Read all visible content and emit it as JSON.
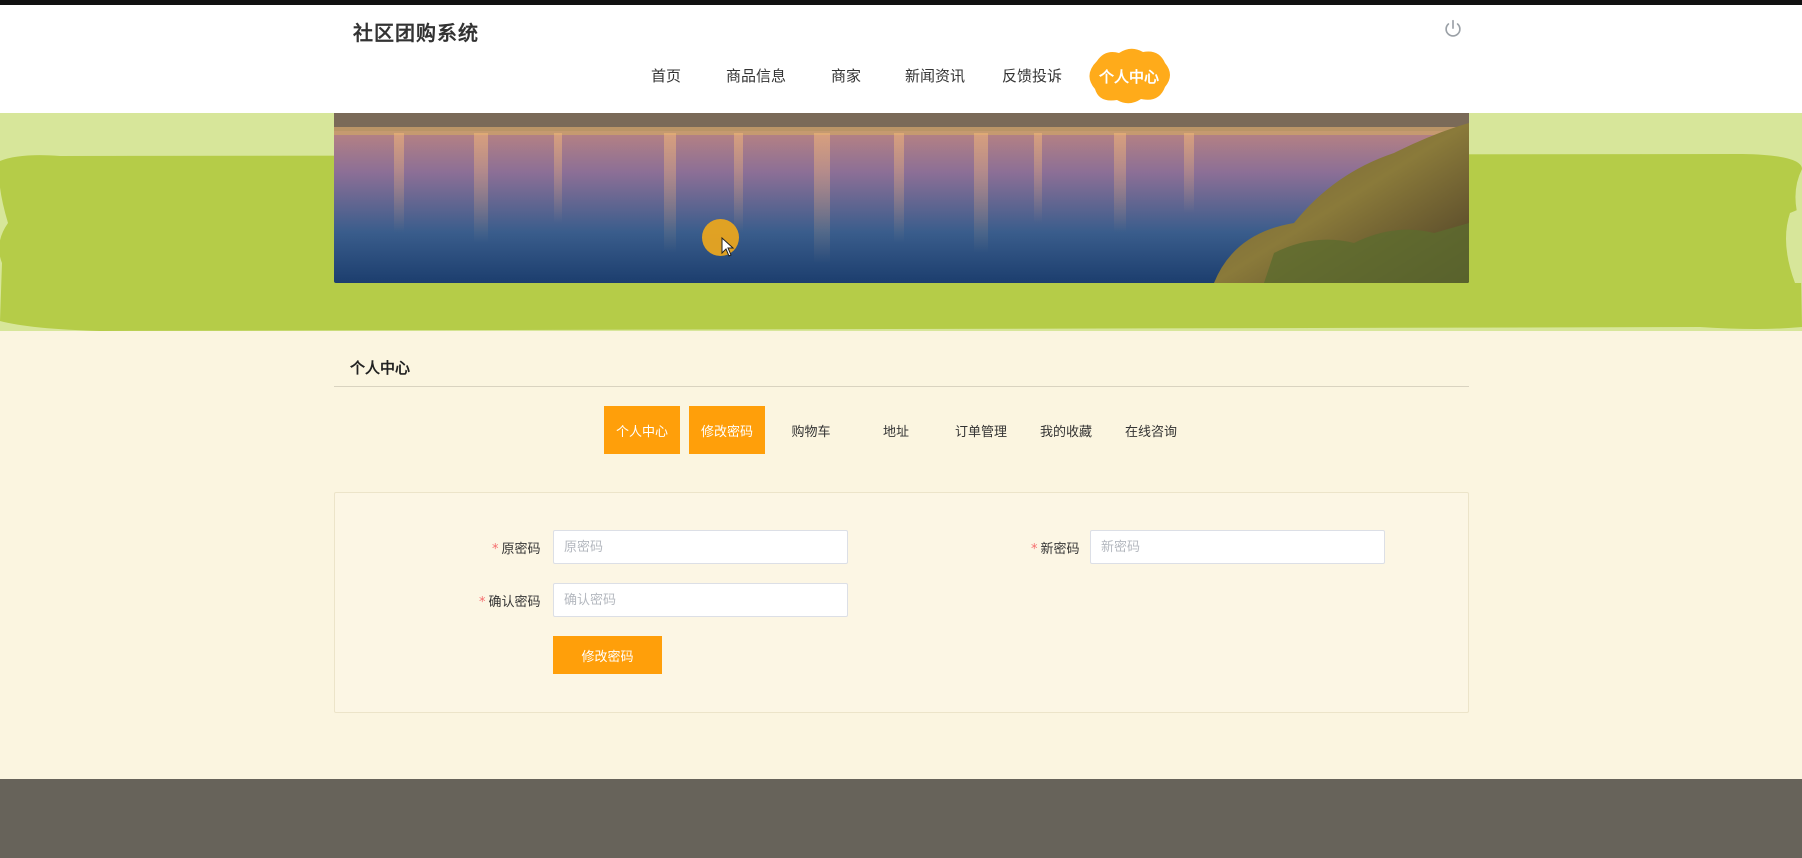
{
  "app": {
    "title": "社区团购系统"
  },
  "nav": {
    "items": [
      {
        "label": "首页"
      },
      {
        "label": "商品信息"
      },
      {
        "label": "商家"
      },
      {
        "label": "新闻资讯"
      },
      {
        "label": "反馈投诉"
      },
      {
        "label": "个人中心",
        "active": true
      }
    ]
  },
  "header": {
    "power_icon": "power-icon"
  },
  "section": {
    "title": "个人中心"
  },
  "tabs": [
    {
      "label": "个人中心",
      "highlighted": true
    },
    {
      "label": "修改密码",
      "highlighted": true
    },
    {
      "label": "购物车"
    },
    {
      "label": "地址"
    },
    {
      "label": "订单管理"
    },
    {
      "label": "我的收藏"
    },
    {
      "label": "在线咨询"
    }
  ],
  "form": {
    "old_password": {
      "label": "原密码",
      "required_mark": "*",
      "placeholder": "原密码",
      "value": ""
    },
    "new_password": {
      "label": "新密码",
      "required_mark": "*",
      "placeholder": "新密码",
      "value": ""
    },
    "confirm_password": {
      "label": "确认密码",
      "required_mark": "*",
      "placeholder": "确认密码",
      "value": ""
    },
    "submit_label": "修改密码"
  },
  "colors": {
    "accent": "#ff9f0a",
    "band_light": "#d7e69a",
    "band_dark": "#b5cc48",
    "page_bg": "#fbf5e0",
    "footer": "#67635a"
  }
}
